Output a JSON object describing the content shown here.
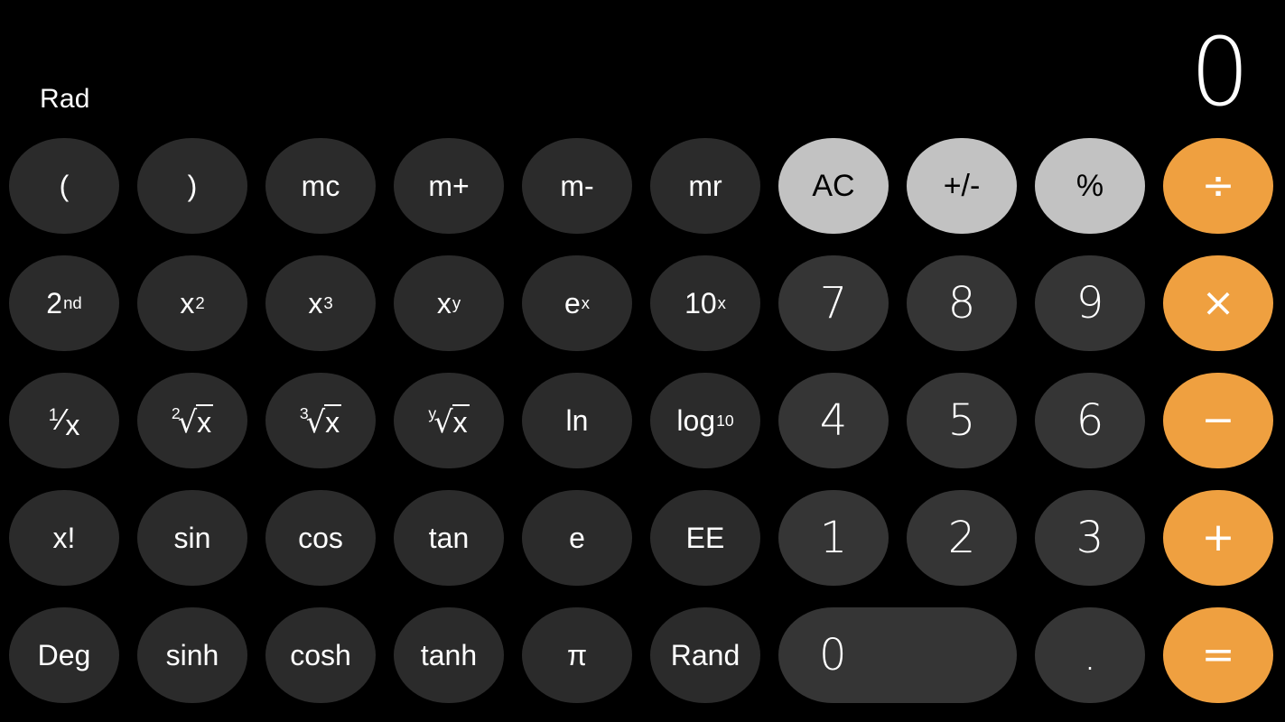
{
  "app": {
    "name": "Calculator",
    "mode": "scientific",
    "theme": "dark"
  },
  "colors": {
    "background": "#000000",
    "function_key": "#2b2b2b",
    "digit_key": "#353535",
    "utility_key": "#c2c2c2",
    "operator_key": "#efa040",
    "text_light": "#ffffff",
    "text_dark": "#000000"
  },
  "display": {
    "mode_indicator": "Rad",
    "value": "0"
  },
  "keypad": {
    "rows": [
      {
        "row_index": 1,
        "keys": [
          {
            "id": "open-paren",
            "label": "(",
            "type": "function"
          },
          {
            "id": "close-paren",
            "label": ")",
            "type": "function"
          },
          {
            "id": "memory-clear",
            "label": "mc",
            "type": "function"
          },
          {
            "id": "memory-add",
            "label": "m+",
            "type": "function"
          },
          {
            "id": "memory-sub",
            "label": "m-",
            "type": "function"
          },
          {
            "id": "memory-recall",
            "label": "mr",
            "type": "function"
          },
          {
            "id": "all-clear",
            "label": "AC",
            "type": "utility"
          },
          {
            "id": "sign-toggle",
            "label": "+/-",
            "type": "utility"
          },
          {
            "id": "percent",
            "label": "%",
            "type": "utility"
          },
          {
            "id": "divide",
            "label": "÷",
            "type": "operator"
          }
        ]
      },
      {
        "row_index": 2,
        "keys": [
          {
            "id": "second",
            "label": "2nd",
            "base": "2",
            "sup": "nd",
            "type": "function"
          },
          {
            "id": "square",
            "label": "x2",
            "base": "x",
            "sup": "2",
            "type": "function"
          },
          {
            "id": "cube",
            "label": "x3",
            "base": "x",
            "sup": "3",
            "type": "function"
          },
          {
            "id": "power-y",
            "label": "xy",
            "base": "x",
            "sup": "y",
            "type": "function"
          },
          {
            "id": "exp-e",
            "label": "ex",
            "base": "e",
            "sup": "x",
            "type": "function"
          },
          {
            "id": "exp-ten",
            "label": "10x",
            "base": "10",
            "sup": "x",
            "type": "function"
          },
          {
            "id": "digit-7",
            "label": "7",
            "type": "digit"
          },
          {
            "id": "digit-8",
            "label": "8",
            "type": "digit"
          },
          {
            "id": "digit-9",
            "label": "9",
            "type": "digit"
          },
          {
            "id": "multiply",
            "label": "×",
            "type": "operator"
          }
        ]
      },
      {
        "row_index": 3,
        "keys": [
          {
            "id": "reciprocal",
            "label": "1/x",
            "num": "1",
            "den": "x",
            "type": "function"
          },
          {
            "id": "square-root",
            "label": "2√x",
            "idx": "2",
            "operand": "x",
            "type": "function"
          },
          {
            "id": "cube-root",
            "label": "3√x",
            "idx": "3",
            "operand": "x",
            "type": "function"
          },
          {
            "id": "nth-root",
            "label": "y√x",
            "idx": "y",
            "operand": "x",
            "type": "function"
          },
          {
            "id": "natural-log",
            "label": "ln",
            "type": "function"
          },
          {
            "id": "log-base-10",
            "label": "log10",
            "base": "log",
            "sub": "10",
            "type": "function"
          },
          {
            "id": "digit-4",
            "label": "4",
            "type": "digit"
          },
          {
            "id": "digit-5",
            "label": "5",
            "type": "digit"
          },
          {
            "id": "digit-6",
            "label": "6",
            "type": "digit"
          },
          {
            "id": "subtract",
            "label": "−",
            "type": "operator"
          }
        ]
      },
      {
        "row_index": 4,
        "keys": [
          {
            "id": "factorial",
            "label": "x!",
            "type": "function"
          },
          {
            "id": "sine",
            "label": "sin",
            "type": "function"
          },
          {
            "id": "cosine",
            "label": "cos",
            "type": "function"
          },
          {
            "id": "tangent",
            "label": "tan",
            "type": "function"
          },
          {
            "id": "euler-e",
            "label": "e",
            "type": "function"
          },
          {
            "id": "ee",
            "label": "EE",
            "type": "function"
          },
          {
            "id": "digit-1",
            "label": "1",
            "type": "digit"
          },
          {
            "id": "digit-2",
            "label": "2",
            "type": "digit"
          },
          {
            "id": "digit-3",
            "label": "3",
            "type": "digit"
          },
          {
            "id": "add",
            "label": "+",
            "type": "operator"
          }
        ]
      },
      {
        "row_index": 5,
        "keys": [
          {
            "id": "degree-mode",
            "label": "Deg",
            "type": "function"
          },
          {
            "id": "hyp-sine",
            "label": "sinh",
            "type": "function"
          },
          {
            "id": "hyp-cosine",
            "label": "cosh",
            "type": "function"
          },
          {
            "id": "hyp-tangent",
            "label": "tanh",
            "type": "function"
          },
          {
            "id": "pi",
            "label": "π",
            "type": "function"
          },
          {
            "id": "random",
            "label": "Rand",
            "type": "function"
          },
          {
            "id": "digit-0",
            "label": "0",
            "type": "digit",
            "wide": true
          },
          {
            "id": "decimal",
            "label": ".",
            "type": "digit"
          },
          {
            "id": "equals",
            "label": "=",
            "type": "operator"
          }
        ]
      }
    ]
  }
}
